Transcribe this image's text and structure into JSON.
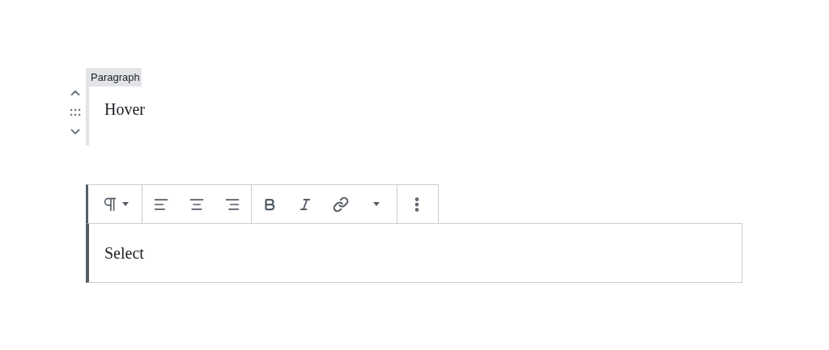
{
  "blocks": [
    {
      "label": "Paragraph",
      "text": "Hover",
      "selected": false
    },
    {
      "text": "Select",
      "selected": true
    }
  ]
}
